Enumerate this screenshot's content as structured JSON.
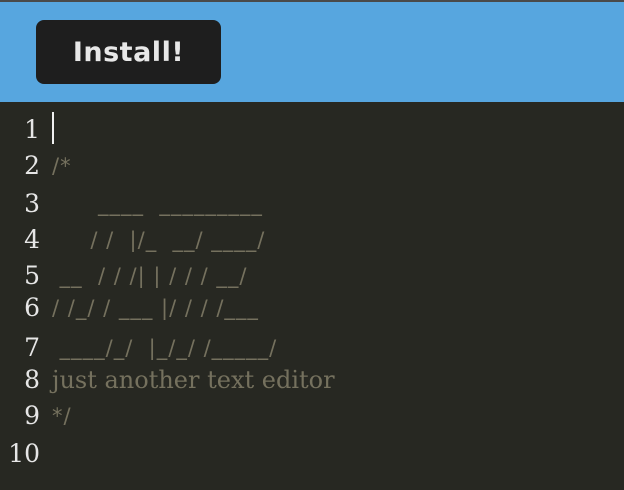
{
  "header": {
    "install_label": "Install!"
  },
  "editor": {
    "lines": [
      {
        "number": "1",
        "text": ""
      },
      {
        "number": "2",
        "text": "/*"
      },
      {
        "number": "3",
        "text": "      ____  _________"
      },
      {
        "number": "4",
        "text": "     / /  |/_  __/ ____/"
      },
      {
        "number": "5",
        "text": " __  / / /| | / / / __/"
      },
      {
        "number": "6",
        "text": "/ /_/ / ___ |/ / / /___"
      },
      {
        "number": "7",
        "text": " ____/_/  |_/_/ /_____/"
      },
      {
        "number": "8",
        "text": "just another text editor"
      },
      {
        "number": "9",
        "text": "*/"
      },
      {
        "number": "10",
        "text": ""
      }
    ]
  },
  "colors": {
    "header_bg": "#57a6df",
    "button_bg": "#1e1e1e",
    "editor_bg": "#272822",
    "comment": "#75715e",
    "gutter_text": "#e6e6e6"
  }
}
